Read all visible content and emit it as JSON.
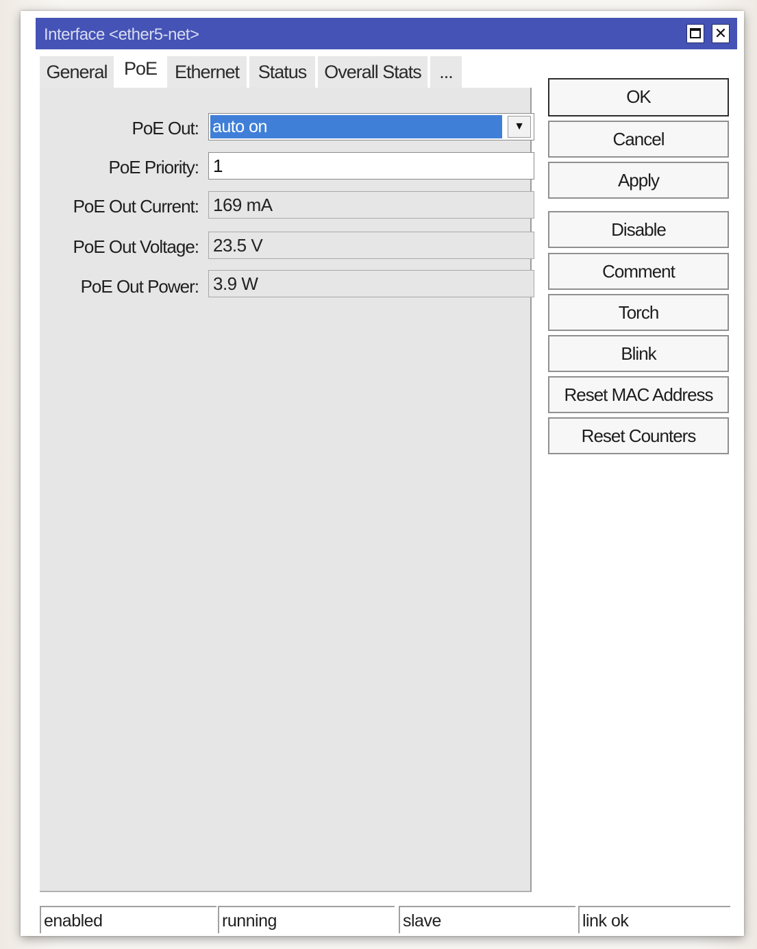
{
  "window": {
    "title": "Interface <ether5-net>",
    "maximize_icon": "maximize-icon",
    "close_icon": "close-icon"
  },
  "tabs": [
    {
      "label": "General",
      "active": false
    },
    {
      "label": "PoE",
      "active": true
    },
    {
      "label": "Ethernet",
      "active": false
    },
    {
      "label": "Status",
      "active": false
    },
    {
      "label": "Overall Stats",
      "active": false
    },
    {
      "label": "...",
      "active": false
    }
  ],
  "form": {
    "poe_out": {
      "label": "PoE Out:",
      "value": "auto on"
    },
    "poe_priority": {
      "label": "PoE Priority:",
      "value": "1"
    },
    "poe_out_current": {
      "label": "PoE Out Current:",
      "value": "169 mA"
    },
    "poe_out_voltage": {
      "label": "PoE Out Voltage:",
      "value": "23.5 V"
    },
    "poe_out_power": {
      "label": "PoE Out Power:",
      "value": "3.9 W"
    }
  },
  "buttons": {
    "ok": "OK",
    "cancel": "Cancel",
    "apply": "Apply",
    "disable": "Disable",
    "comment": "Comment",
    "torch": "Torch",
    "blink": "Blink",
    "reset_mac": "Reset MAC Address",
    "reset_counters": "Reset Counters"
  },
  "status_bar": [
    "enabled",
    "running",
    "slave",
    "link ok"
  ],
  "colors": {
    "titlebar": "#4453b5",
    "selection": "#3f7fd8",
    "panel": "#e6e6e6"
  }
}
